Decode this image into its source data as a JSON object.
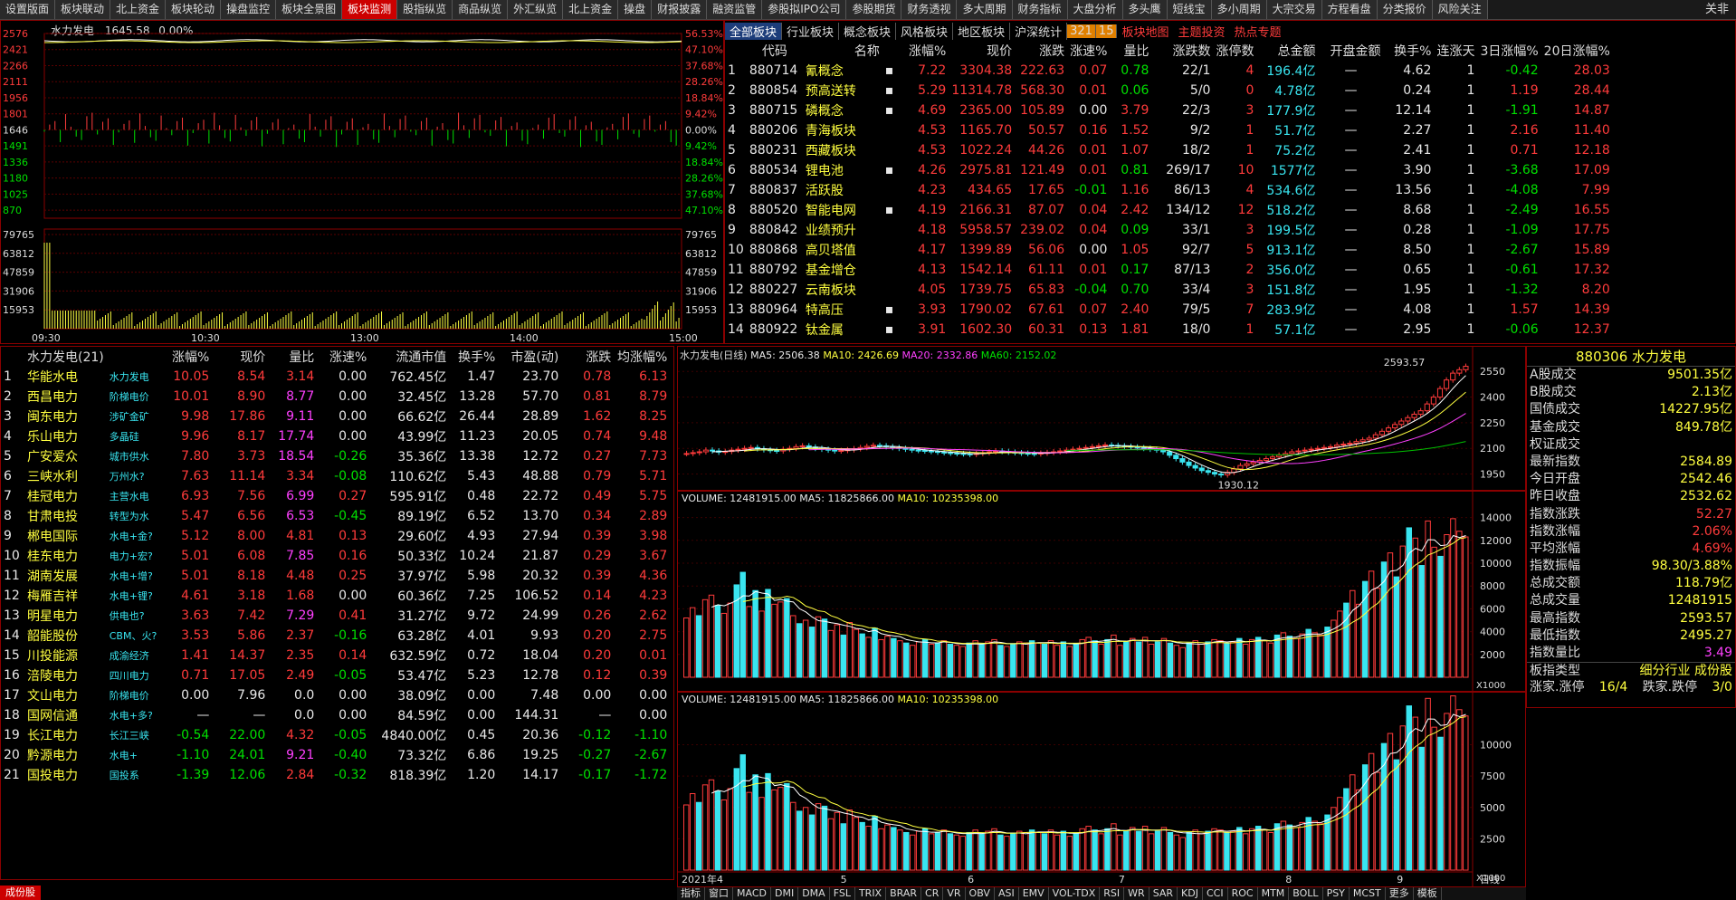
{
  "topbar": {
    "tabs": [
      "设置版面",
      "板块联动",
      "北上资金",
      "板块轮动",
      "操盘监控",
      "板块全景图",
      "板块监测",
      "股指纵览",
      "商品纵览",
      "外汇纵览",
      "北上资金",
      "操盘",
      "财报披露",
      "融资监管",
      "参股拟IPO公司",
      "参股期货",
      "财务透视",
      "多大周期",
      "财务指标",
      "大盘分析",
      "多头鹰",
      "短线宝",
      "多小周期",
      "大宗交易",
      "方程看盘",
      "分类报价",
      "风险关注"
    ],
    "active_index": 6,
    "right_label": "关非"
  },
  "intraday": {
    "title": "水力发电",
    "price": "1645.58",
    "pct": "0.00%",
    "y_left": [
      "2576",
      "2421",
      "2266",
      "2111",
      "1956",
      "1801",
      "1646",
      "1491",
      "1336",
      "1180",
      "1025",
      "870"
    ],
    "y_right": [
      "56.53%",
      "47.10%",
      "37.68%",
      "28.26%",
      "18.84%",
      "9.42%",
      "0.00%",
      "9.42%",
      "18.84%",
      "28.26%",
      "37.68%",
      "47.10%"
    ],
    "vol_left": [
      "79765",
      "63812",
      "47859",
      "31906",
      "15953"
    ],
    "vol_right": [
      "79765",
      "63812",
      "47859",
      "31906",
      "15953"
    ],
    "times": [
      "09:30",
      "10:30",
      "13:00",
      "14:00",
      "15:00"
    ]
  },
  "sectors": {
    "tabs": [
      "全部板块",
      "行业板块",
      "概念板块",
      "风格板块",
      "地区板块",
      "沪深统计"
    ],
    "badge": "321",
    "badge2": "15",
    "links": [
      "板块地图",
      "主题投资",
      "热点专题"
    ],
    "headers": [
      "",
      "代码",
      "名称",
      "",
      "涨幅%",
      "现价",
      "涨跌",
      "涨速%",
      "量比",
      "涨跌数",
      "涨停数",
      "总金额",
      "开盘金额",
      "换手%",
      "连涨天",
      "3日涨幅%",
      "20日涨幅%"
    ],
    "rows": [
      [
        "1",
        "880714",
        "氰概念",
        "▪",
        "7.22",
        "3304.38",
        "222.63",
        "0.07",
        "0.78",
        "22/1",
        "4",
        "196.4亿",
        "—",
        "4.62",
        "1",
        "-0.42",
        "28.03"
      ],
      [
        "2",
        "880854",
        "预高送转",
        "▪",
        "5.29",
        "11314.78",
        "568.30",
        "0.01",
        "0.06",
        "5/0",
        "0",
        "4.78亿",
        "—",
        "0.24",
        "1",
        "1.19",
        "28.44"
      ],
      [
        "3",
        "880715",
        "磷概念",
        "▪",
        "4.69",
        "2365.00",
        "105.89",
        "0.00",
        "3.79",
        "22/3",
        "3",
        "177.9亿",
        "—",
        "12.14",
        "1",
        "-1.91",
        "14.87"
      ],
      [
        "4",
        "880206",
        "青海板块",
        "",
        "4.53",
        "1165.70",
        "50.57",
        "0.16",
        "1.52",
        "9/2",
        "1",
        "51.7亿",
        "—",
        "2.27",
        "1",
        "2.16",
        "11.40"
      ],
      [
        "5",
        "880231",
        "西藏板块",
        "",
        "4.53",
        "1022.24",
        "44.26",
        "0.01",
        "1.07",
        "18/2",
        "1",
        "75.2亿",
        "—",
        "2.41",
        "1",
        "0.71",
        "12.18"
      ],
      [
        "6",
        "880534",
        "锂电池",
        "▪",
        "4.26",
        "2975.81",
        "121.49",
        "0.01",
        "0.81",
        "269/17",
        "10",
        "1577亿",
        "—",
        "3.90",
        "1",
        "-3.68",
        "17.09"
      ],
      [
        "7",
        "880837",
        "活跃股",
        "",
        "4.23",
        "434.65",
        "17.65",
        "-0.01",
        "1.16",
        "86/13",
        "4",
        "534.6亿",
        "—",
        "13.56",
        "1",
        "-4.08",
        "7.99"
      ],
      [
        "8",
        "880520",
        "智能电网",
        "▪",
        "4.19",
        "2166.31",
        "87.07",
        "0.04",
        "2.42",
        "134/12",
        "12",
        "518.2亿",
        "—",
        "8.68",
        "1",
        "-2.49",
        "16.55"
      ],
      [
        "9",
        "880842",
        "业绩预升",
        "",
        "4.18",
        "5958.57",
        "239.02",
        "0.04",
        "0.09",
        "33/1",
        "3",
        "199.5亿",
        "—",
        "0.28",
        "1",
        "-1.09",
        "17.75"
      ],
      [
        "10",
        "880868",
        "高贝塔值",
        "",
        "4.17",
        "1399.89",
        "56.06",
        "0.00",
        "1.05",
        "92/7",
        "5",
        "913.1亿",
        "—",
        "8.50",
        "1",
        "-2.67",
        "15.89"
      ],
      [
        "11",
        "880792",
        "基金增仓",
        "",
        "4.13",
        "1542.14",
        "61.11",
        "0.01",
        "0.17",
        "87/13",
        "2",
        "356.0亿",
        "—",
        "0.65",
        "1",
        "-0.61",
        "17.32"
      ],
      [
        "12",
        "880227",
        "云南板块",
        "",
        "4.05",
        "1739.75",
        "65.83",
        "-0.04",
        "0.70",
        "33/4",
        "3",
        "151.8亿",
        "—",
        "1.95",
        "1",
        "-1.32",
        "8.20"
      ],
      [
        "13",
        "880964",
        "特高压",
        "▪",
        "3.93",
        "1790.02",
        "67.61",
        "0.07",
        "2.40",
        "79/5",
        "7",
        "283.9亿",
        "—",
        "4.08",
        "1",
        "1.57",
        "14.39"
      ],
      [
        "14",
        "880922",
        "钛金属",
        "▪",
        "3.91",
        "1602.30",
        "60.31",
        "0.13",
        "1.81",
        "18/0",
        "1",
        "57.1亿",
        "—",
        "2.95",
        "1",
        "-0.06",
        "12.37"
      ]
    ]
  },
  "stocks": {
    "headers": [
      "",
      "水力发电(21)",
      "",
      "涨幅%",
      "现价",
      "量比",
      "涨速%",
      "流通市值",
      "换手%",
      "市盈(动)",
      "涨跌",
      "均涨幅%"
    ],
    "rows": [
      [
        "1",
        "华能水电",
        "水力发电",
        "10.05",
        "8.54",
        "3.14",
        "0.00",
        "762.45亿",
        "1.47",
        "23.70",
        "0.78",
        "6.13"
      ],
      [
        "2",
        "西昌电力",
        "阶梯电价",
        "10.01",
        "8.90",
        "8.77",
        "0.00",
        "32.45亿",
        "13.28",
        "57.70",
        "0.81",
        "8.79"
      ],
      [
        "3",
        "闽东电力",
        "涉矿金矿",
        "9.98",
        "17.86",
        "9.11",
        "0.00",
        "66.62亿",
        "26.44",
        "28.89",
        "1.62",
        "8.25"
      ],
      [
        "4",
        "乐山电力",
        "多晶硅",
        "9.96",
        "8.17",
        "17.74",
        "0.00",
        "43.99亿",
        "11.23",
        "20.05",
        "0.74",
        "9.48"
      ],
      [
        "5",
        "广安爱众",
        "城市供水",
        "7.80",
        "3.73",
        "18.54",
        "-0.26",
        "35.36亿",
        "13.38",
        "12.72",
        "0.27",
        "7.73"
      ],
      [
        "6",
        "三峡水利",
        "万州水?",
        "7.63",
        "11.14",
        "3.34",
        "-0.08",
        "110.62亿",
        "5.43",
        "48.88",
        "0.79",
        "5.71"
      ],
      [
        "7",
        "桂冠电力",
        "主营水电",
        "6.93",
        "7.56",
        "6.99",
        "0.27",
        "595.91亿",
        "0.48",
        "22.72",
        "0.49",
        "5.75"
      ],
      [
        "8",
        "甘肃电投",
        "转型为水",
        "5.47",
        "6.56",
        "6.53",
        "-0.45",
        "89.19亿",
        "6.52",
        "13.70",
        "0.34",
        "2.89"
      ],
      [
        "9",
        "郴电国际",
        "水电+金?",
        "5.12",
        "8.00",
        "4.81",
        "0.13",
        "29.60亿",
        "4.93",
        "27.94",
        "0.39",
        "3.98"
      ],
      [
        "10",
        "桂东电力",
        "电力+宏?",
        "5.01",
        "6.08",
        "7.85",
        "0.16",
        "50.33亿",
        "10.24",
        "21.87",
        "0.29",
        "3.67"
      ],
      [
        "11",
        "湖南发展",
        "水电+增?",
        "5.01",
        "8.18",
        "4.48",
        "0.25",
        "37.97亿",
        "5.98",
        "20.32",
        "0.39",
        "4.36"
      ],
      [
        "12",
        "梅雁吉祥",
        "水电+锂?",
        "4.61",
        "3.18",
        "1.68",
        "0.00",
        "60.36亿",
        "7.25",
        "106.52",
        "0.14",
        "4.23"
      ],
      [
        "13",
        "明星电力",
        "供电也?",
        "3.63",
        "7.42",
        "7.29",
        "0.41",
        "31.27亿",
        "9.72",
        "24.99",
        "0.26",
        "2.62"
      ],
      [
        "14",
        "韶能股份",
        "CBM、火?",
        "3.53",
        "5.86",
        "2.37",
        "-0.16",
        "63.28亿",
        "4.01",
        "9.93",
        "0.20",
        "2.75"
      ],
      [
        "15",
        "川投能源",
        "成渝经济",
        "1.41",
        "14.37",
        "2.35",
        "0.14",
        "632.59亿",
        "0.72",
        "18.04",
        "0.20",
        "0.01"
      ],
      [
        "16",
        "涪陵电力",
        "四川电力",
        "0.71",
        "17.05",
        "2.49",
        "-0.05",
        "53.47亿",
        "5.23",
        "12.78",
        "0.12",
        "0.39"
      ],
      [
        "17",
        "文山电力",
        "阶梯电价",
        "0.00",
        "7.96",
        "0.0",
        "0.00",
        "38.09亿",
        "0.00",
        "7.48",
        "0.00",
        "0.00"
      ],
      [
        "18",
        "国网信通",
        "水电+多?",
        "—",
        "—",
        "0.0",
        "0.00",
        "84.59亿",
        "0.00",
        "144.31",
        "—",
        "0.00"
      ],
      [
        "19",
        "长江电力",
        "长江三峡",
        "-0.54",
        "22.00",
        "4.32",
        "-0.05",
        "4840.00亿",
        "0.45",
        "20.36",
        "-0.12",
        "-1.10"
      ],
      [
        "20",
        "黔源电力",
        "水电+",
        "-1.10",
        "24.01",
        "9.21",
        "-0.40",
        "73.32亿",
        "6.86",
        "19.25",
        "-0.27",
        "-2.67"
      ],
      [
        "21",
        "国投电力",
        "国投系",
        "-1.39",
        "12.06",
        "2.84",
        "-0.32",
        "818.39亿",
        "1.20",
        "14.17",
        "-0.17",
        "-1.72"
      ]
    ]
  },
  "kline": {
    "title": "水力发电(日线)",
    "ma5": "MA5: 2506.38",
    "ma10": "MA10: 2426.69",
    "ma20": "MA20: 2332.86",
    "ma60": "MA60: 2152.02",
    "high_label": "2593.57",
    "low_label": "1930.12",
    "y": [
      "2550",
      "2400",
      "2250",
      "2100",
      "1950"
    ],
    "candles": [
      2070,
      2075,
      2080,
      2090,
      2085,
      2078,
      2082,
      2090,
      2095,
      2100,
      2105,
      2098,
      2092,
      2088,
      2085,
      2095,
      2100,
      2110,
      2115,
      2108,
      2100,
      2095,
      2090,
      2085,
      2088,
      2092,
      2098,
      2105,
      2112,
      2118,
      2115,
      2110,
      2105,
      2100,
      2095,
      2090,
      2088,
      2085,
      2082,
      2078,
      2075,
      2072,
      2070,
      2068,
      2065,
      2070,
      2075,
      2080,
      2085,
      2082,
      2078,
      2075,
      2072,
      2070,
      2068,
      2072,
      2076,
      2080,
      2085,
      2090,
      2095,
      2100,
      2105,
      2110,
      2115,
      2120,
      2118,
      2115,
      2112,
      2108,
      2104,
      2100,
      2095,
      2090,
      2080,
      2060,
      2040,
      2020,
      2000,
      1985,
      1970,
      1960,
      1950,
      1945,
      1960,
      1980,
      2000,
      2010,
      2020,
      2030,
      2040,
      2050,
      2060,
      2070,
      2080,
      2085,
      2090,
      2095,
      2100,
      2105,
      2110,
      2120,
      2125,
      2130,
      2140,
      2150,
      2160,
      2180,
      2200,
      2220,
      2240,
      2260,
      2280,
      2300,
      2320,
      2360,
      2400,
      2450,
      2500,
      2540,
      2560,
      2580
    ]
  },
  "vol1": {
    "label": "VOLUME: 12481915.00",
    "ma5": "MA5: 11825866.00",
    "ma10": "MA10: 10235398.00",
    "y": [
      "14000",
      "12000",
      "10000",
      "8000",
      "6000",
      "4000",
      "2000"
    ],
    "unit": "X1000"
  },
  "vol2": {
    "label": "VOLUME: 12481915.00",
    "ma5": "MA5: 11825866.00",
    "ma10": "MA10: 10235398.00",
    "y": [
      "10000",
      "7500",
      "5000",
      "2500"
    ],
    "unit": "X1000",
    "dates": [
      "2021年4",
      "5",
      "6",
      "7",
      "8",
      "9"
    ],
    "right_label": "日线"
  },
  "volumes": [
    5200,
    6100,
    5400,
    6800,
    7200,
    6300,
    5600,
    6500,
    8100,
    9200,
    6200,
    7600,
    5800,
    7700,
    6400,
    6600,
    6900,
    5400,
    4700,
    5000,
    4400,
    5300,
    5100,
    4100,
    4600,
    3700,
    4800,
    4200,
    3800,
    3500,
    4300,
    3300,
    3600,
    3400,
    3200,
    3000,
    2800,
    3100,
    3300,
    2900,
    3000,
    3200,
    2900,
    2800,
    2700,
    3000,
    3200,
    2900,
    3100,
    3300,
    2800,
    2700,
    2900,
    3100,
    3000,
    3200,
    3000,
    2900,
    3200,
    2800,
    3100,
    2700,
    2900,
    3300,
    3500,
    3200,
    2900,
    3300,
    3700,
    2800,
    3100,
    3400,
    3100,
    3500,
    2900,
    3100,
    3400,
    3000,
    2800,
    2600,
    3000,
    3200,
    2900,
    3100,
    3300,
    3200,
    3000,
    3100,
    3400,
    2900,
    3300,
    3500,
    3200,
    3000,
    3700,
    3900,
    3600,
    3400,
    3800,
    4200,
    3900,
    3700,
    4400,
    5000,
    5800,
    6500,
    7600,
    6400,
    8400,
    9300,
    7800,
    10100,
    10900,
    8800,
    11500,
    13100,
    12200,
    9800,
    13700,
    11400,
    10600,
    12500,
    13900,
    12800,
    12300
  ],
  "vol_up": [
    true,
    true,
    false,
    true,
    true,
    false,
    true,
    true,
    false,
    false,
    true,
    false,
    true,
    false,
    true,
    true,
    false,
    true,
    false,
    true,
    false,
    true,
    false,
    true,
    true,
    false,
    true,
    true,
    false,
    true,
    false,
    true,
    true,
    false,
    true,
    false,
    true,
    true,
    false,
    true,
    false,
    true,
    false,
    true,
    true,
    false,
    true,
    false,
    true,
    true,
    false,
    true,
    false,
    true,
    true,
    false,
    true,
    false,
    true,
    true,
    false,
    true,
    false,
    true,
    true,
    false,
    true,
    false,
    true,
    true,
    false,
    true,
    false,
    true,
    true,
    false,
    true,
    false,
    true,
    true,
    false,
    true,
    true,
    false,
    true,
    true,
    false,
    true,
    false,
    true,
    true,
    false,
    true,
    true,
    false,
    true,
    false,
    true,
    true,
    false,
    true,
    true,
    false,
    true,
    true,
    false,
    true,
    true,
    false,
    true,
    true,
    false,
    true,
    false,
    true,
    false,
    true,
    false,
    true,
    true,
    false,
    true,
    true,
    true
  ],
  "info": {
    "title": "880306 水力发电",
    "rows": [
      [
        "A股成交",
        "9501.35亿"
      ],
      [
        "B股成交",
        "2.13亿"
      ],
      [
        "国债成交",
        "14227.95亿"
      ],
      [
        "基金成交",
        "849.78亿"
      ],
      [
        "权证成交",
        ""
      ],
      [
        "最新指数",
        "2584.89"
      ],
      [
        "今日开盘",
        "2542.46"
      ],
      [
        "昨日收盘",
        "2532.62"
      ],
      [
        "指数涨跌",
        "52.27"
      ],
      [
        "指数涨幅",
        "2.06%"
      ],
      [
        "平均涨幅",
        "4.69%"
      ],
      [
        "指数振幅",
        "98.30/3.88%"
      ],
      [
        "总成交额",
        "118.79亿"
      ],
      [
        "总成交量",
        "12481915"
      ],
      [
        "最高指数",
        "2593.57"
      ],
      [
        "最低指数",
        "2495.27"
      ],
      [
        "指数量比",
        "3.49"
      ]
    ],
    "type_label": "板指类型",
    "type_value": "细分行业 成份股",
    "zd_label": "涨家.涨停",
    "zd_value": "16/4",
    "df_label": "跌家.跌停",
    "df_value": "3/0"
  },
  "bottombar": [
    "指标",
    "窗口",
    "MACD",
    "DMI",
    "DMA",
    "FSL",
    "TRIX",
    "BRAR",
    "CR",
    "VR",
    "OBV",
    "ASI",
    "EMV",
    "VOL-TDX",
    "RSI",
    "WR",
    "SAR",
    "KDJ",
    "CCI",
    "ROC",
    "MTM",
    "BOLL",
    "PSY",
    "MCST",
    "更多",
    "模板"
  ],
  "corner": "成份股",
  "colors": {
    "red": "#ff3b3b",
    "green": "#00e000",
    "cyan": "#39e5f0",
    "yellow": "#ffff40",
    "border": "#8b0000"
  }
}
